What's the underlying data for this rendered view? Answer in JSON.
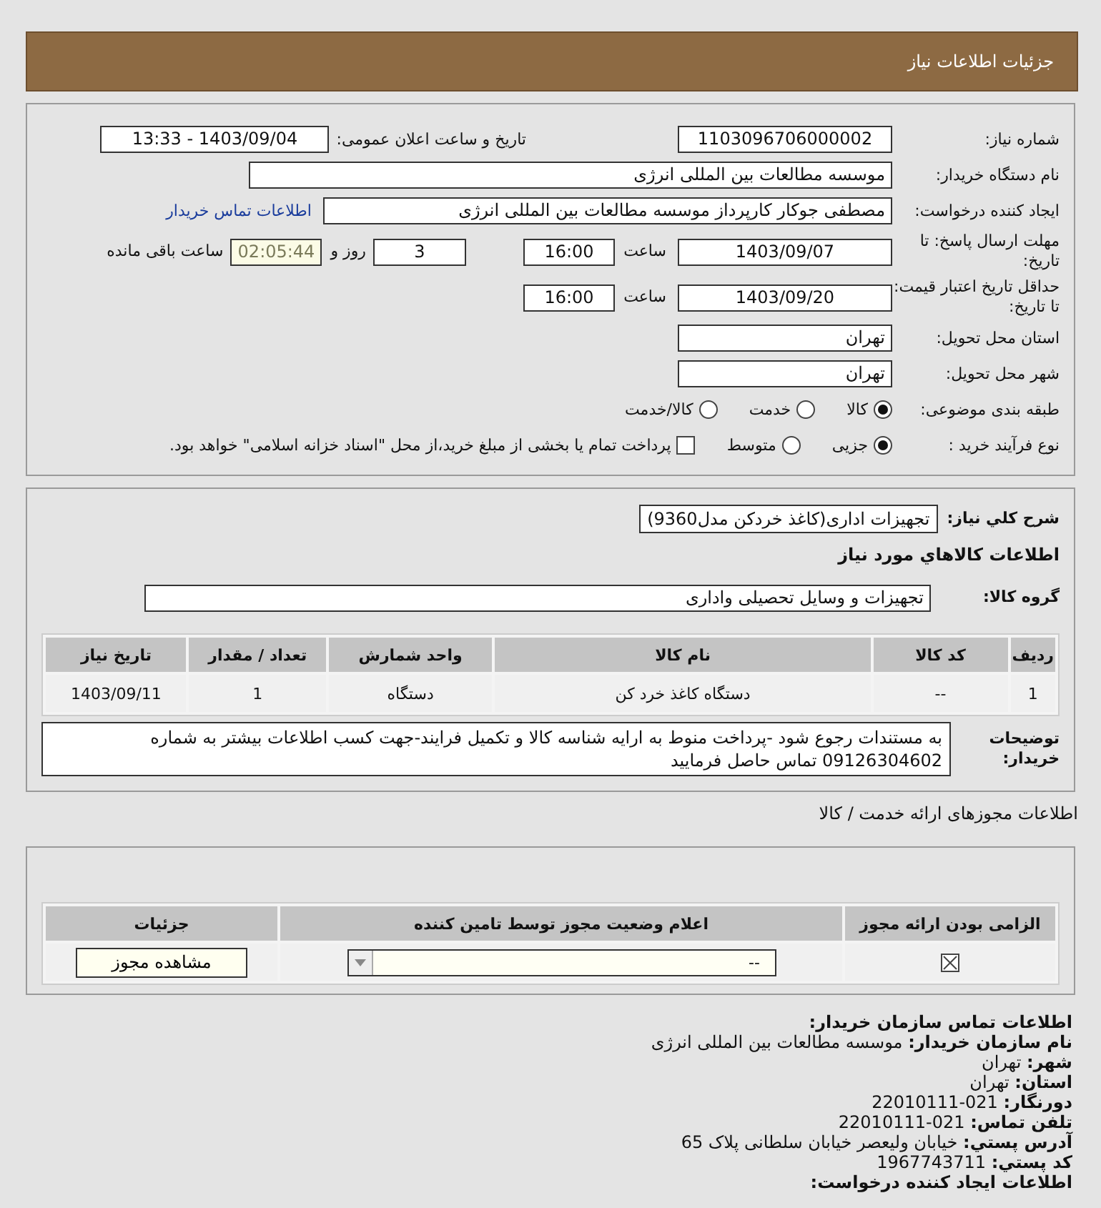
{
  "header": {
    "title": "جزئیات اطلاعات نیاز"
  },
  "details": {
    "need_number": {
      "label": "شماره نیاز:",
      "value": "1103096706000002"
    },
    "announce": {
      "label": "تاریخ و ساعت اعلان عمومی:",
      "value": "1403/09/04 - 13:33"
    },
    "buyer": {
      "label": "نام دستگاه خریدار:",
      "value": "موسسه مطالعات بین المللی انرژی"
    },
    "creator": {
      "label": "ایجاد کننده درخواست:",
      "value": "مصطفی جوکار کارپرداز موسسه مطالعات بین المللی انرژی",
      "link": "اطلاعات تماس خریدار"
    },
    "deadline": {
      "label": "مهلت ارسال پاسخ: تا تاریخ:",
      "date": "1403/09/07",
      "time_label": "ساعت",
      "time": "16:00",
      "days": "3",
      "days_label": "روز و",
      "remaining": "02:05:44",
      "remaining_label": "ساعت باقی مانده"
    },
    "validity": {
      "label": "حداقل تاریخ اعتبار قیمت: تا تاریخ:",
      "date": "1403/09/20",
      "time_label": "ساعت",
      "time": "16:00"
    },
    "province": {
      "label": "استان محل تحویل:",
      "value": "تهران"
    },
    "city": {
      "label": "شهر محل تحویل:",
      "value": "تهران"
    },
    "category": {
      "label": "طبقه بندی موضوعی:",
      "options": [
        {
          "label": "کالا",
          "selected": true
        },
        {
          "label": "خدمت",
          "selected": false
        },
        {
          "label": "کالا/خدمت",
          "selected": false
        }
      ]
    },
    "process": {
      "label": "نوع فرآیند خرید :",
      "options": [
        {
          "label": "جزیی",
          "selected": true
        },
        {
          "label": "متوسط",
          "selected": false
        }
      ],
      "treasury": {
        "label": "پرداخت تمام یا بخشی از مبلغ خرید،از محل \"اسناد خزانه اسلامی\" خواهد بود.",
        "checked": false
      }
    }
  },
  "goods": {
    "summary": {
      "label": "شرح کلي نیاز:",
      "value": "تجهیزات اداری(کاغذ خردکن مدل9360)"
    },
    "title": "اطلاعات کالاهاي مورد نیاز",
    "group": {
      "label": "گروه کالا:",
      "value": "تجهیزات و وسایل تحصیلی واداری"
    },
    "table": {
      "columns": [
        "ردیف",
        "کد کالا",
        "نام کالا",
        "واحد شمارش",
        "تعداد / مقدار",
        "تاریخ نیاز"
      ],
      "rows": [
        [
          "1",
          "--",
          "دستگاه کاغذ خرد کن",
          "دستگاه",
          "1",
          "1403/09/11"
        ]
      ]
    },
    "notes": {
      "label": "توضیحات خریدار:",
      "value": "به مستندات رجوع شود -پرداخت منوط به ارایه شناسه کالا و تکمیل فرایند-جهت کسب اطلاعات بیشتر به شماره 09126304602 تماس حاصل فرمایید"
    }
  },
  "permits": {
    "title": "اطلاعات مجوزهای ارائه خدمت / کالا",
    "columns": [
      "الزامی بودن ارائه مجوز",
      "اعلام وضعیت مجوز توسط تامین کننده",
      "جزئیات"
    ],
    "rows": [
      {
        "required": true,
        "status": "--",
        "button": "مشاهده مجوز"
      }
    ]
  },
  "contact": {
    "title": "اطلاعات تماس سازمان خریدار:",
    "lines": [
      {
        "label": "نام سازمان خریدار:",
        "value": "موسسه مطالعات بین المللی انرژی"
      },
      {
        "label": "شهر:",
        "value": "تهران"
      },
      {
        "label": "استان:",
        "value": "تهران"
      },
      {
        "label": "دورنگار:",
        "value": "021-22010111"
      },
      {
        "label": "تلفن تماس:",
        "value": "021-22010111"
      },
      {
        "label": "آدرس پستي:",
        "value": "خیابان ولیعصر خیابان سلطانی پلاک 65"
      },
      {
        "label": "کد پستي:",
        "value": "1967743711"
      }
    ],
    "next_title": "اطلاعات ایجاد کننده درخواست:"
  }
}
